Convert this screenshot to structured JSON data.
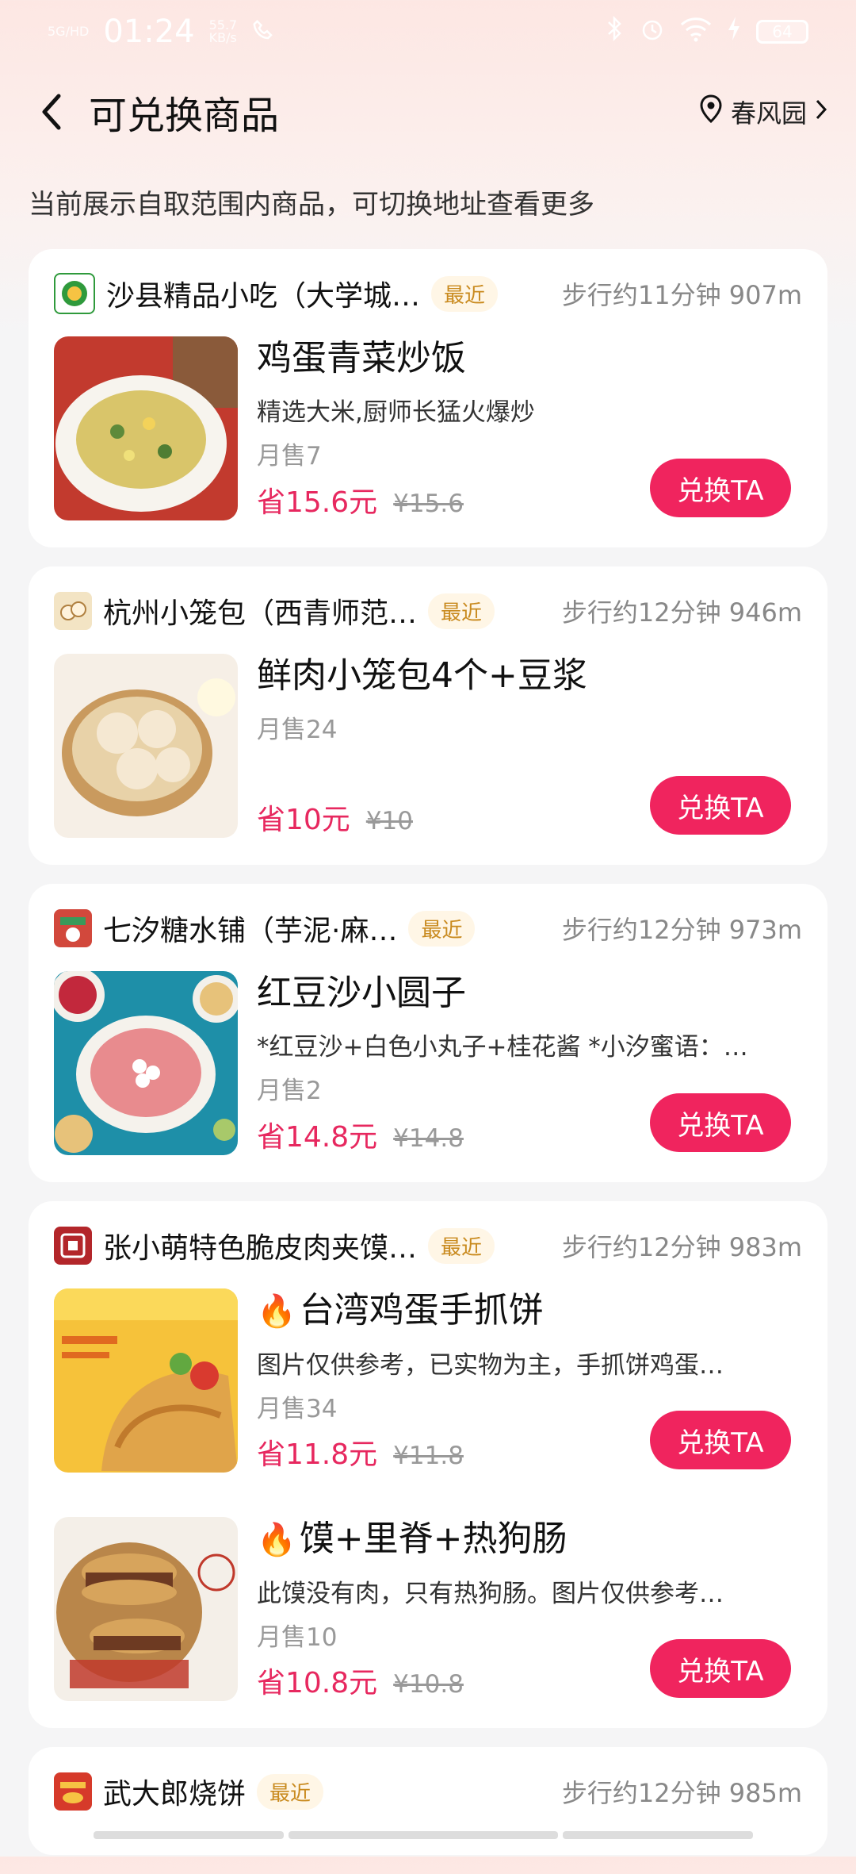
{
  "status_bar": {
    "net_label": "5G/HD",
    "time": "01:24",
    "speed": "55.7",
    "speed_unit": "KB/s",
    "battery": "64"
  },
  "header": {
    "title": "可兑换商品",
    "location": "春风园"
  },
  "notice": "当前展示自取范围内商品，可切换地址查看更多",
  "shops": [
    {
      "name": "沙县精品小吃（大学城…",
      "badge": "最近",
      "distance": "步行约11分钟 907m",
      "logo_color": "#2f9a3c",
      "items": [
        {
          "title": "鸡蛋青菜炒饭",
          "desc": "精选大米,厨师长猛火爆炒",
          "sold": "月售7",
          "save": "省15.6元",
          "orig": "¥15.6",
          "button": "兑换TA"
        }
      ]
    },
    {
      "name": "杭州小笼包（西青师范…",
      "badge": "最近",
      "distance": "步行约12分钟 946m",
      "logo_color": "#c8a060",
      "items": [
        {
          "title": "鲜肉小笼包4个+豆浆",
          "desc": "",
          "sold": "月售24",
          "save": "省10元",
          "orig": "¥10",
          "button": "兑换TA"
        }
      ]
    },
    {
      "name": "七汐糖水铺（芋泥·麻…",
      "badge": "最近",
      "distance": "步行约12分钟 973m",
      "logo_color": "#d2483c",
      "items": [
        {
          "title": "红豆沙小圆子",
          "desc": "*红豆沙+白色小丸子+桂花酱 *小汐蜜语：…",
          "sold": "月售2",
          "save": "省14.8元",
          "orig": "¥14.8",
          "button": "兑换TA"
        }
      ]
    },
    {
      "name": "张小萌特色脆皮肉夹馍…",
      "badge": "最近",
      "distance": "步行约12分钟 983m",
      "logo_color": "#b3262a",
      "items": [
        {
          "fire": "🔥",
          "title": "台湾鸡蛋手抓饼",
          "desc": "图片仅供参考，已实物为主，手抓饼鸡蛋…",
          "sold": "月售34",
          "save": "省11.8元",
          "orig": "¥11.8",
          "button": "兑换TA"
        },
        {
          "fire": "🔥",
          "title": "馍+里脊+热狗肠",
          "desc": "此馍没有肉，只有热狗肠。图片仅供参考…",
          "sold": "月售10",
          "save": "省10.8元",
          "orig": "¥10.8",
          "button": "兑换TA"
        }
      ]
    },
    {
      "name": "武大郎烧饼",
      "badge": "最近",
      "distance": "步行约12分钟 985m",
      "logo_color": "#d63a2a"
    }
  ],
  "icons": {
    "back": "back-arrow-icon",
    "location": "location-pin-icon",
    "chevron": "chevron-right-icon",
    "fire": "fire-icon"
  },
  "colors": {
    "accent": "#f0245e",
    "save_price": "#e7285f",
    "badge_text": "#c98a1e"
  }
}
